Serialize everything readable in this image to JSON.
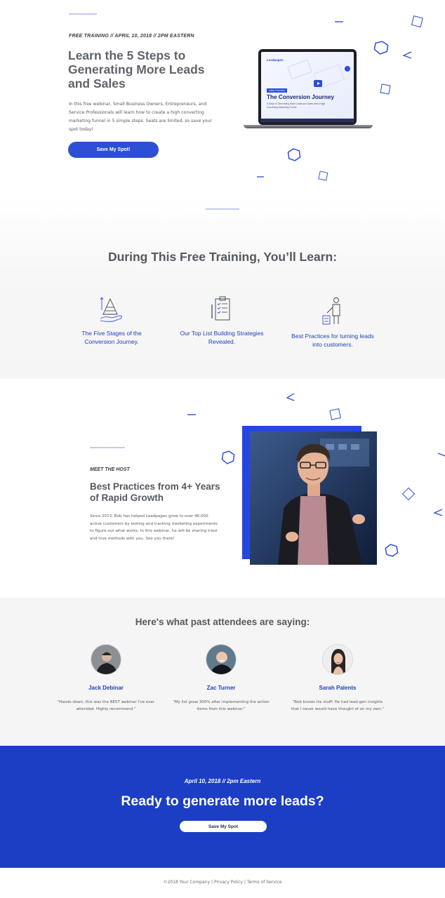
{
  "hero": {
    "kicker": "FREE TRAINING // APRIL 10, 2018 // 2PM EASTERN",
    "title": "Learn the 5 Steps to Generating More Leads and Sales",
    "description": "In this free webinar, Small Business Owners, Entrepreneurs, and Service Professionals will learn how to create a high converting marketing funnel in 5 simple steps. Seats are limited, so save your spot today!",
    "cta_label": "Save My Spot!",
    "video": {
      "brand": "Leadpages",
      "tag": "FREE TRAINING",
      "title": "The Conversion Journey",
      "subtitle": "5 Steps to Generating More Leads and Sales with a High Converting Marketing Funnel"
    }
  },
  "learn": {
    "heading": "During This Free Training, You’ll Learn:",
    "features": [
      {
        "icon": "pyramid-hand-icon",
        "label": "The Five Stages of the Conversion Journey."
      },
      {
        "icon": "clipboard-list-icon",
        "label": "Our Top List Building Strategies Revealed."
      },
      {
        "icon": "person-podium-icon",
        "label": "Best Practices for turning leads into customers."
      }
    ]
  },
  "host": {
    "kicker": "MEET THE HOST",
    "title": "Best Practices from 4+ Years of Rapid Growth",
    "description": "Since 2013, Bob has helped Leadpages grow to over 46,000 active customers by testing and tracking marketing experiments to figure out what works. In this webinar, he will be sharing tried and true methods with you. See you there!"
  },
  "testimonials": {
    "heading": "Here's what past attendees are saying:",
    "items": [
      {
        "name": "Jack Debinar",
        "quote": "\"Hands down, this was the BEST webinar I've ever attended. Highly recommend.\""
      },
      {
        "name": "Zac Turner",
        "quote": "\"My list grew 300% after implementing the action items from this webinar.\""
      },
      {
        "name": "Sarah Palents",
        "quote": "\"Bob knows his stuff! He had lead-gen insights that I never would have thought of on my own.\""
      }
    ]
  },
  "cta": {
    "date": "April 10, 2018 // 2pm Eastern",
    "title": "Ready to generate more leads?",
    "button_label": "Save My Spot"
  },
  "footer": {
    "copyright": "©2018 Your Company",
    "privacy": "Privacy Policy",
    "terms": "Terms of Service"
  },
  "colors": {
    "primary": "#2d4fd6",
    "cta_background": "#1c3ec4",
    "link_blue": "#1f3fb8",
    "heading_gray": "#55595f"
  }
}
